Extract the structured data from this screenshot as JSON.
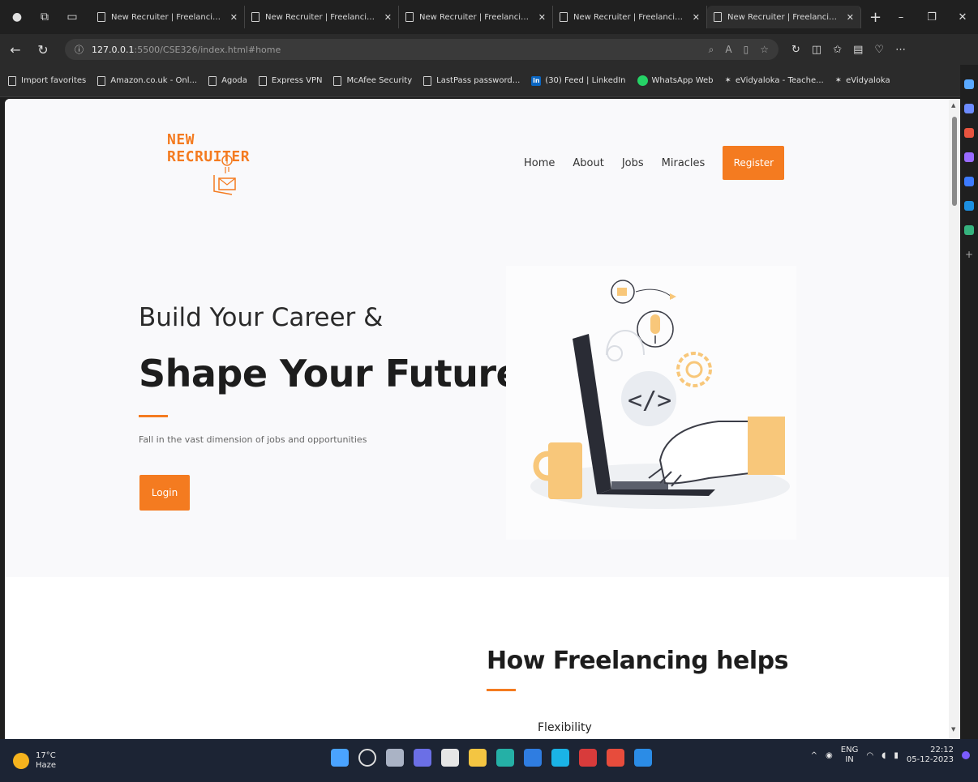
{
  "browser": {
    "tabs": [
      {
        "title": "New Recruiter | Freelancing from"
      },
      {
        "title": "New Recruiter | Freelancing from"
      },
      {
        "title": "New Recruiter | Freelancing from"
      },
      {
        "title": "New Recruiter | Freelancing from"
      },
      {
        "title": "New Recruiter | Freelancing from"
      }
    ],
    "url_host": "127.0.0.1",
    "url_path": ":5500/CSE326/index.html#home",
    "favorites": [
      {
        "label": "Import favorites"
      },
      {
        "label": "Amazon.co.uk - Onl..."
      },
      {
        "label": "Agoda"
      },
      {
        "label": "Express VPN"
      },
      {
        "label": "McAfee Security"
      },
      {
        "label": "LastPass password..."
      },
      {
        "label": "(30) Feed | LinkedIn"
      },
      {
        "label": "WhatsApp Web"
      },
      {
        "label": "eVidyaloka - Teache..."
      },
      {
        "label": "eVidyaloka"
      }
    ]
  },
  "site": {
    "logo": "NEW RECRUITER",
    "nav": {
      "home": "Home",
      "about": "About",
      "jobs": "Jobs",
      "miracles": "Miracles",
      "register": "Register"
    },
    "hero": {
      "line1": "Build Your Career &",
      "line2": "Shape Your Future!",
      "subtitle": "Fall in the vast dimension of jobs and opportunities",
      "login": "Login"
    },
    "section": {
      "title": "How Freelancing helps",
      "first_item": "Flexibility"
    }
  },
  "taskbar": {
    "temp": "17°C",
    "weather": "Haze",
    "lang1": "ENG",
    "lang2": "IN",
    "time": "22:12",
    "date": "05-12-2023"
  },
  "colors": {
    "accent": "#f47b20",
    "hero_bg": "#f9f9fb",
    "taskbar": "#1c2434"
  }
}
